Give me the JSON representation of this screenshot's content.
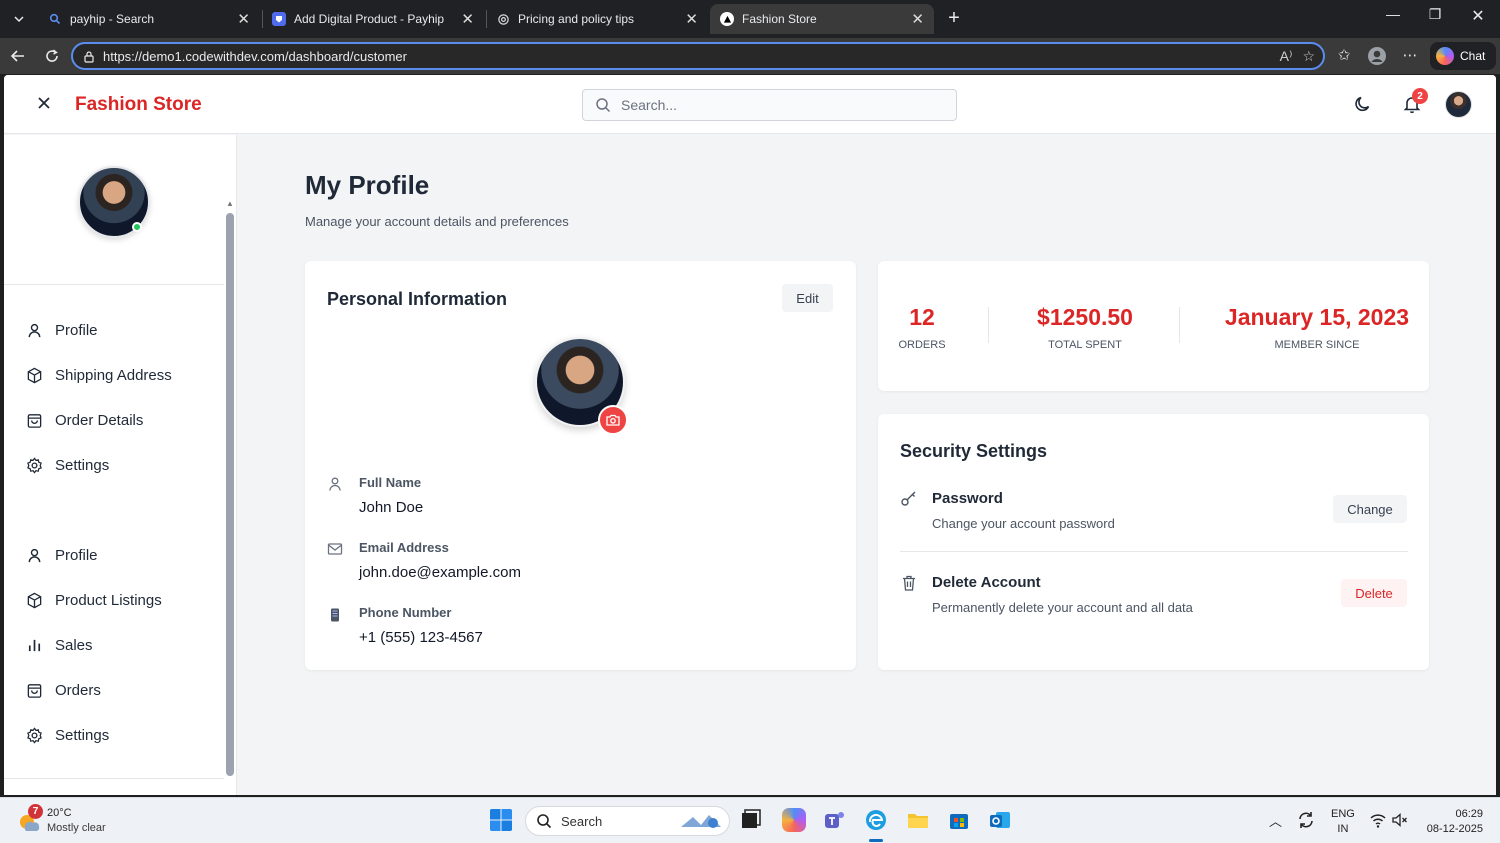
{
  "browser": {
    "tabs": [
      {
        "title": "payhip - Search",
        "active": false
      },
      {
        "title": "Add Digital Product - Payhip",
        "active": false
      },
      {
        "title": "Pricing and policy tips",
        "active": false
      },
      {
        "title": "Fashion Store",
        "active": true
      }
    ],
    "url": "https://demo1.codewithdev.com/dashboard/customer",
    "chat_label": "Chat"
  },
  "header": {
    "brand": "Fashion Store",
    "search_placeholder": "Search...",
    "notification_count": "2"
  },
  "sidebar": {
    "group1": [
      {
        "label": "Profile",
        "icon": "user-icon"
      },
      {
        "label": "Shipping Address",
        "icon": "package-icon"
      },
      {
        "label": "Order Details",
        "icon": "shopping-bag-icon"
      },
      {
        "label": "Settings",
        "icon": "gear-icon"
      }
    ],
    "group2": [
      {
        "label": "Profile",
        "icon": "user-icon"
      },
      {
        "label": "Product Listings",
        "icon": "package-icon"
      },
      {
        "label": "Sales",
        "icon": "bar-chart-icon"
      },
      {
        "label": "Orders",
        "icon": "shopping-bag-icon"
      },
      {
        "label": "Settings",
        "icon": "gear-icon"
      }
    ]
  },
  "page": {
    "title": "My Profile",
    "subtitle": "Manage your account details and preferences"
  },
  "personal_info": {
    "title": "Personal Information",
    "edit_label": "Edit",
    "fields": [
      {
        "label": "Full Name",
        "value": "John Doe"
      },
      {
        "label": "Email Address",
        "value": "john.doe@example.com"
      },
      {
        "label": "Phone Number",
        "value": "+1 (555) 123-4567"
      }
    ]
  },
  "stats": [
    {
      "value": "12",
      "label": "ORDERS"
    },
    {
      "value": "$1250.50",
      "label": "TOTAL SPENT"
    },
    {
      "value": "January 15, 2023",
      "label": "MEMBER SINCE"
    }
  ],
  "security": {
    "title": "Security Settings",
    "items": [
      {
        "title": "Password",
        "desc": "Change your account password",
        "action": "Change"
      },
      {
        "title": "Delete Account",
        "desc": "Permanently delete your account and all data",
        "action": "Delete"
      }
    ]
  },
  "taskbar": {
    "weather_badge": "7",
    "temperature": "20°C",
    "weather": "Mostly clear",
    "search_label": "Search",
    "lang_top": "ENG",
    "lang_bottom": "IN",
    "time": "06:29",
    "date": "08-12-2025"
  },
  "colors": {
    "brand": "#dc2626",
    "accent_border": "#5b8def",
    "online": "#22c55e"
  }
}
